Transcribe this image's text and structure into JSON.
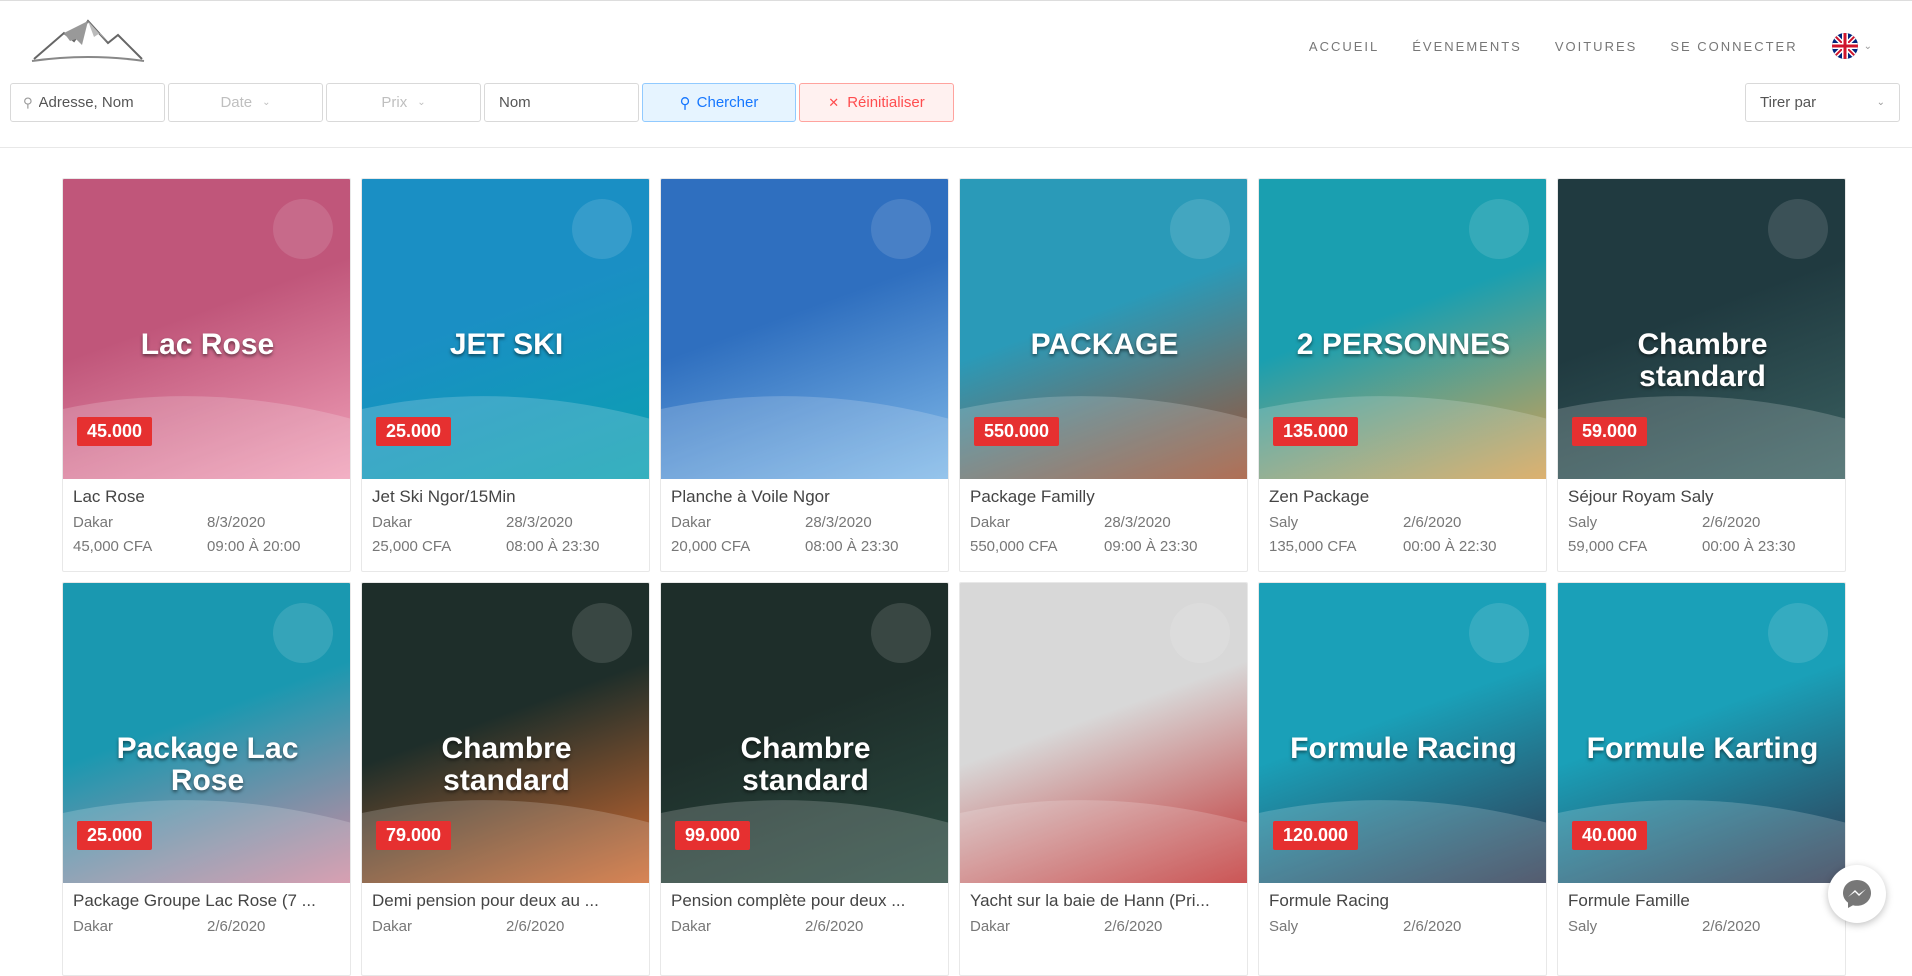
{
  "nav": {
    "items": [
      "ACCUEIL",
      "ÉVENEMENTS",
      "VOITURES",
      "SE CONNECTER"
    ],
    "language_icon": "uk-flag-icon"
  },
  "filters": {
    "address_value": "Adresse, Nom",
    "date_label": "Date",
    "price_label": "Prix",
    "name_placeholder": "Nom",
    "search_label": "Chercher",
    "reset_label": "Réinitialiser",
    "sort_label": "Tirer par"
  },
  "cards": [
    {
      "title": "Lac Rose",
      "city": "Dakar",
      "date": "8/3/2020",
      "price": "45,000 CFA",
      "hours": "09:00 À 20:00",
      "bg": "#c0567a",
      "bg2": "#f0a0b8",
      "overlay": "Lac Rose",
      "badge": "45.000",
      "badgeColor": "#e63030"
    },
    {
      "title": "Jet Ski Ngor/15Min",
      "city": "Dakar",
      "date": "28/3/2020",
      "price": "25,000 CFA",
      "hours": "08:00 À 23:30",
      "bg": "#1a8fc4",
      "bg2": "#0aa0b0",
      "overlay": "JET SKI",
      "badge": "25.000",
      "badgeColor": "#e63030"
    },
    {
      "title": "Planche à Voile Ngor",
      "city": "Dakar",
      "date": "28/3/2020",
      "price": "20,000 CFA",
      "hours": "08:00 À 23:30",
      "bg": "#2f6fbf",
      "bg2": "#7fb8e8",
      "overlay": "",
      "badge": "",
      "badgeColor": ""
    },
    {
      "title": "Package Familly",
      "city": "Dakar",
      "date": "28/3/2020",
      "price": "550,000 CFA",
      "hours": "09:00 À 23:30",
      "bg": "#2a9ab8",
      "bg2": "#a05030",
      "overlay": "PACKAGE",
      "badge": "550.000",
      "badgeColor": "#e63030"
    },
    {
      "title": "Zen Package",
      "city": "Saly",
      "date": "2/6/2020",
      "price": "135,000 CFA",
      "hours": "00:00 À 22:30",
      "bg": "#1a9fb0",
      "bg2": "#d6a050",
      "overlay": "2 PERSONNES",
      "badge": "135.000",
      "badgeColor": "#e63030"
    },
    {
      "title": "Séjour Royam Saly",
      "city": "Saly",
      "date": "2/6/2020",
      "price": "59,000 CFA",
      "hours": "00:00 À 23:30",
      "bg": "#203a40",
      "bg2": "#3a6060",
      "overlay": "Chambre standard",
      "badge": "59.000",
      "badgeColor": "#e63030"
    },
    {
      "title": "Package Groupe Lac Rose (7 ...",
      "city": "Dakar",
      "date": "2/6/2020",
      "price": "",
      "hours": "",
      "bg": "#1a98b0",
      "bg2": "#d08aa0",
      "overlay": "Package Lac Rose",
      "badge": "25.000",
      "badgeColor": "#e63030"
    },
    {
      "title": "Demi pension pour deux au ...",
      "city": "Dakar",
      "date": "2/6/2020",
      "price": "",
      "hours": "",
      "bg": "#1e2e2a",
      "bg2": "#d06a30",
      "overlay": "Chambre standard",
      "badge": "79.000",
      "badgeColor": "#e63030"
    },
    {
      "title": "Pension complète pour deux ...",
      "city": "Dakar",
      "date": "2/6/2020",
      "price": "",
      "hours": "",
      "bg": "#1e2e2a",
      "bg2": "#2a4a40",
      "overlay": "Chambre standard",
      "badge": "99.000",
      "badgeColor": "#e63030"
    },
    {
      "title": "Yacht sur la baie de Hann (Pri...",
      "city": "Dakar",
      "date": "2/6/2020",
      "price": "",
      "hours": "",
      "bg": "#d8d8d8",
      "bg2": "#c03030",
      "overlay": "",
      "badge": "",
      "badgeColor": ""
    },
    {
      "title": "Formule Racing",
      "city": "Saly",
      "date": "2/6/2020",
      "price": "",
      "hours": "",
      "bg": "#1aa0b8",
      "bg2": "#303850",
      "overlay": "Formule Racing",
      "badge": "120.000",
      "badgeColor": "#e63030"
    },
    {
      "title": "Formule Famille",
      "city": "Saly",
      "date": "2/6/2020",
      "price": "",
      "hours": "",
      "bg": "#1aa0b8",
      "bg2": "#303850",
      "overlay": "Formule Karting",
      "badge": "40.000",
      "badgeColor": "#e63030"
    }
  ],
  "colors": {
    "accent_blue": "#1677ff",
    "danger_red": "#ff4d4f",
    "nav_text": "#777777"
  }
}
